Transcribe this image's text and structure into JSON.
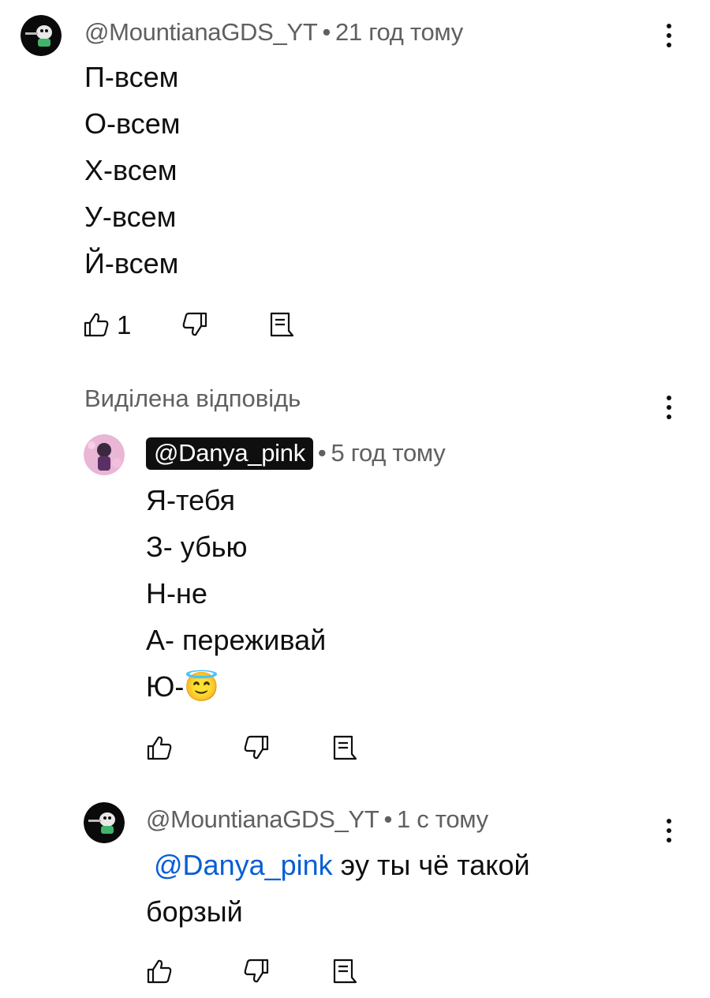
{
  "comments": [
    {
      "author": "@MountianaGDS_YT",
      "separator": "•",
      "time": "21 год тому",
      "lines": [
        "П-всем",
        "О-всем",
        "Х-всем",
        "У-всем",
        "Й-всем"
      ],
      "likes": "1"
    },
    {
      "featured_label": "Виділена відповідь",
      "author": "@Danya_pink",
      "separator": "•",
      "time": "5 год тому",
      "lines": [
        "Я-тебя",
        "З- убью",
        "Н-не",
        "А- переживай",
        "Ю-"
      ],
      "emoji": "😇"
    },
    {
      "author": "@MountianaGDS_YT",
      "separator": "•",
      "time": "1 с тому",
      "mention": "@Danya_pink",
      "text_after_mention": " эу ты чё такой",
      "line2": "борзый"
    }
  ],
  "icons": {
    "like": "thumb-up-icon",
    "dislike": "thumb-down-icon",
    "reply": "reply-comment-icon",
    "more": "more-vertical-icon"
  },
  "colors": {
    "text": "#0f0f0f",
    "secondary_text": "#606060",
    "mention": "#065fd4",
    "chip_bg": "#0f0f0f"
  }
}
